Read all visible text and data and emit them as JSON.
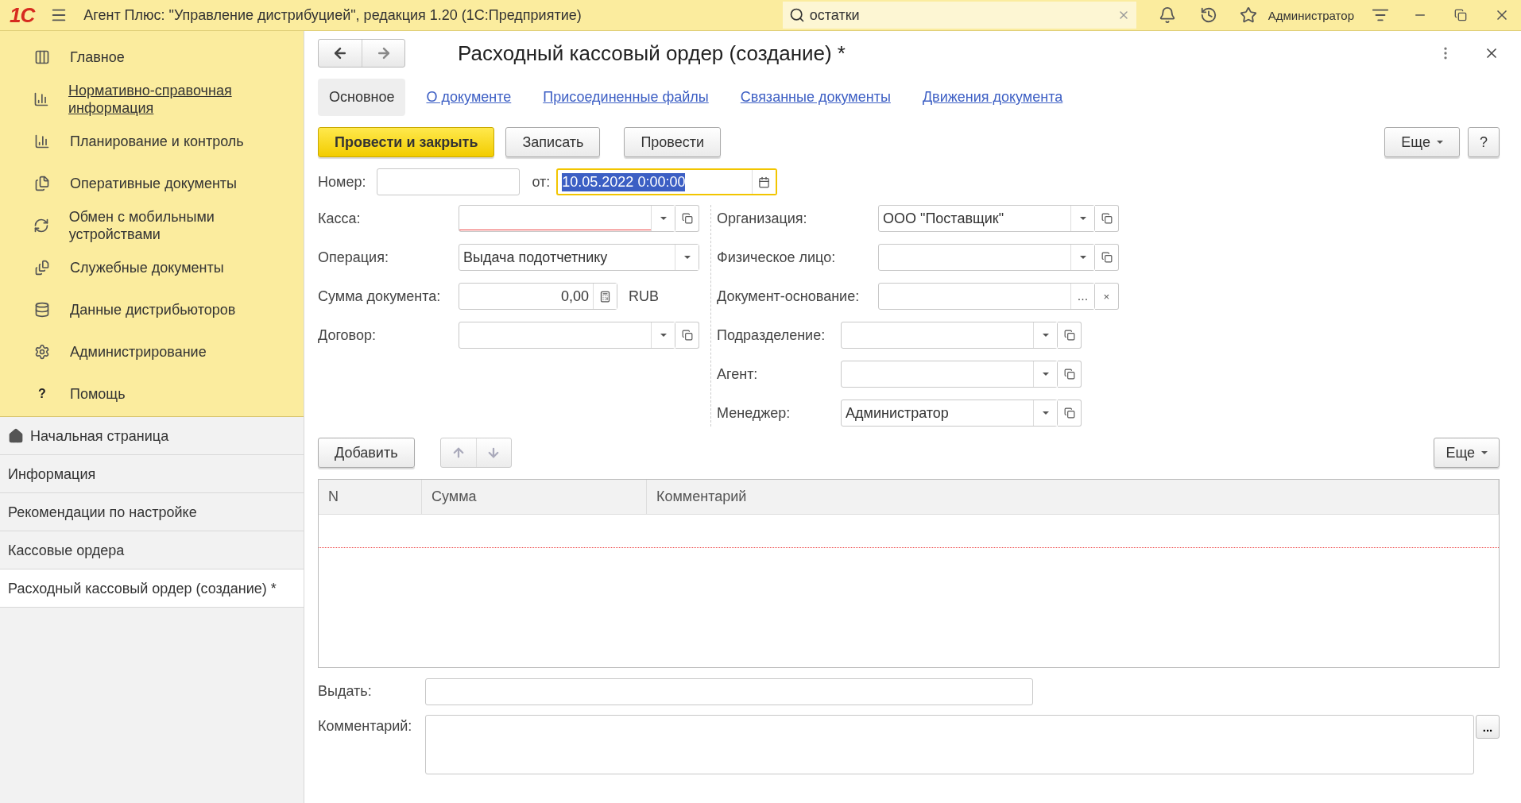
{
  "app_bar": {
    "logo": "1С",
    "title": "Агент Плюс: \"Управление дистрибуцией\", редакция 1.20  (1С:Предприятие)",
    "search": {
      "value": "остатки"
    },
    "user": "Администратор"
  },
  "sidebar": {
    "sections": [
      {
        "label": "Главное",
        "hovered": false
      },
      {
        "label": "Нормативно-справочная информация",
        "hovered": true
      },
      {
        "label": "Планирование и контроль",
        "hovered": false
      },
      {
        "label": "Оперативные документы",
        "hovered": false
      },
      {
        "label": "Обмен с мобильными устройствами",
        "hovered": false
      },
      {
        "label": "Служебные документы",
        "hovered": false
      },
      {
        "label": "Данные дистрибьюторов",
        "hovered": false
      },
      {
        "label": "Администрирование",
        "hovered": false
      },
      {
        "label": "Помощь",
        "hovered": false,
        "icon_text": "?"
      }
    ],
    "open_windows": [
      {
        "label": "Начальная страница",
        "kind": "home",
        "selected": false
      },
      {
        "label": "Информация",
        "kind": "page",
        "selected": false
      },
      {
        "label": "Рекомендации по настройке",
        "kind": "page",
        "selected": false
      },
      {
        "label": "Кассовые ордера",
        "kind": "page",
        "selected": false
      },
      {
        "label": "Расходный кассовый ордер (создание) *",
        "kind": "page",
        "selected": true
      }
    ]
  },
  "form": {
    "title": "Расходный кассовый ордер (создание) *",
    "tabs": [
      {
        "label": "Основное",
        "selected": true
      },
      {
        "label": "О документе",
        "selected": false
      },
      {
        "label": "Присоединенные файлы",
        "selected": false
      },
      {
        "label": "Связанные документы",
        "selected": false
      },
      {
        "label": "Движения документа",
        "selected": false
      }
    ],
    "buttons": [
      {
        "label": "Провести и закрыть",
        "primary": true
      },
      {
        "label": "Записать",
        "primary": false
      },
      {
        "label": "Провести",
        "primary": false
      }
    ],
    "more_button": "Еще",
    "help_button": "?",
    "number": {
      "label": "Номер:"
    },
    "date": {
      "label": "от:",
      "value": "10.05.2022  0:00:00",
      "focused": true
    },
    "left_fields": [
      {
        "label": "Касса:",
        "kind": "select",
        "required": true
      },
      {
        "label": "Операция:",
        "kind": "choice",
        "value": "Выдача подотчетнику",
        "required": false
      },
      {
        "label": "Сумма документа:",
        "kind": "amount",
        "value": "0,00",
        "currency": "RUB",
        "required": false
      },
      {
        "label": "Договор:",
        "kind": "select",
        "required": false
      }
    ],
    "right_fields_a": [
      {
        "label": "Организация:",
        "kind": "select",
        "value": "ООО \"Поставщик\"",
        "required": false
      },
      {
        "label": "Физическое лицо:",
        "kind": "select",
        "required": false
      },
      {
        "label": "Документ-основание:",
        "kind": "pick",
        "pick_button": "...",
        "clear_button": "×",
        "required": false
      }
    ],
    "right_fields_b": [
      {
        "label": "Подразделение:",
        "kind": "select",
        "required": false
      },
      {
        "label": "Агент:",
        "kind": "select",
        "required": false
      },
      {
        "label": "Менеджер:",
        "kind": "select",
        "value": "Администратор",
        "required": false
      }
    ],
    "table": {
      "add_button": "Добавить",
      "more_button": "Еще",
      "columns": [
        "N",
        "Сумма",
        "Комментарий"
      ]
    },
    "issue": {
      "label": "Выдать:"
    },
    "comment": {
      "label": "Комментарий:",
      "button": "..."
    }
  }
}
